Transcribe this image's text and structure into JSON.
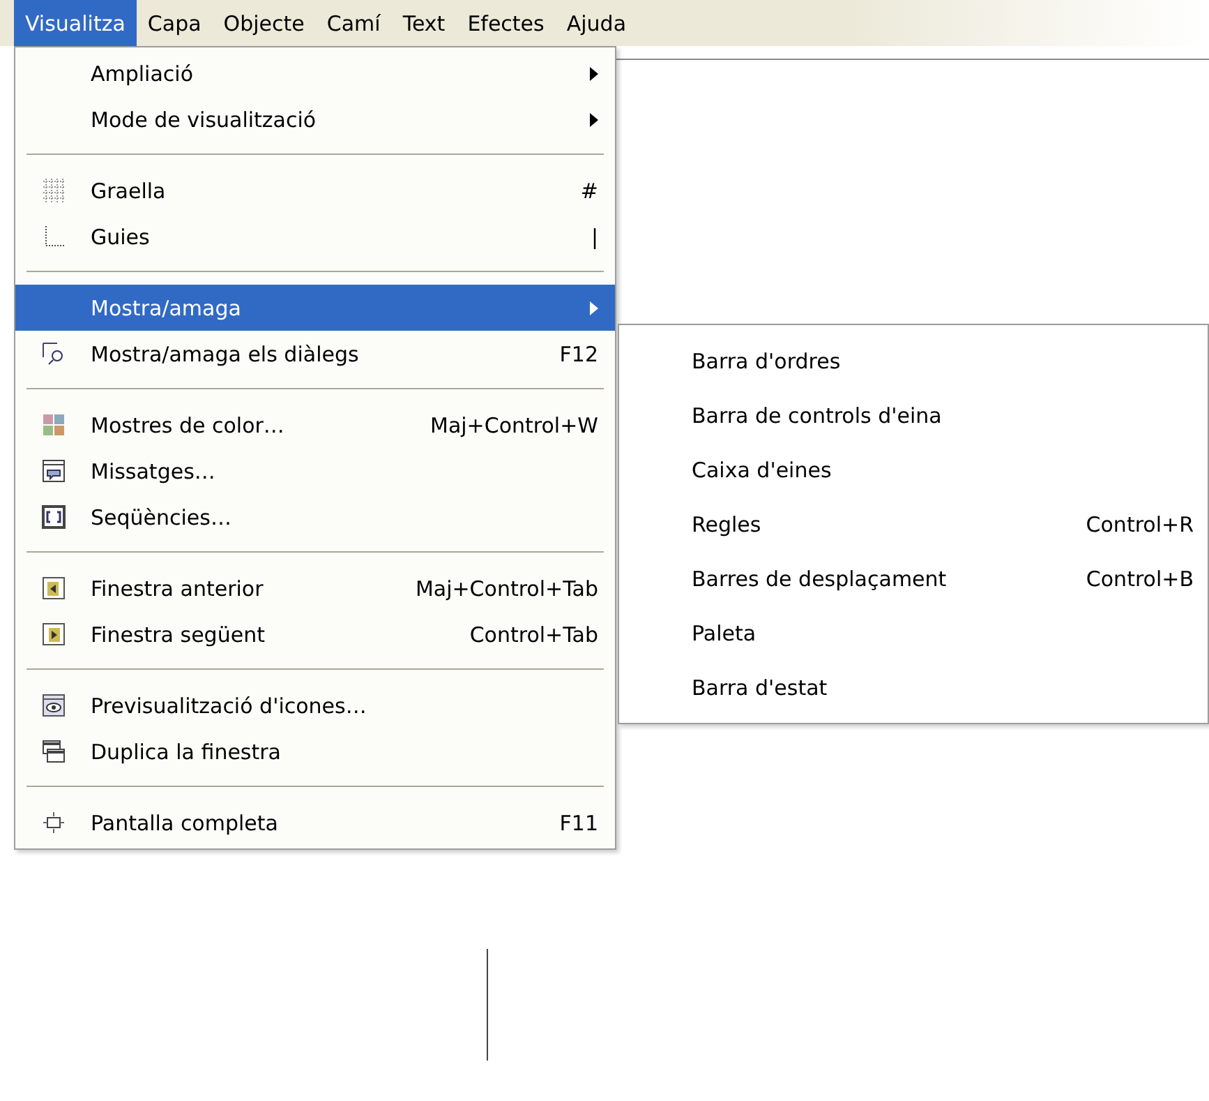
{
  "menubar": [
    {
      "label": "Visualitza",
      "selected": true
    },
    {
      "label": "Capa",
      "selected": false
    },
    {
      "label": "Objecte",
      "selected": false
    },
    {
      "label": "Camí",
      "selected": false
    },
    {
      "label": "Text",
      "selected": false
    },
    {
      "label": "Efectes",
      "selected": false
    },
    {
      "label": "Ajuda",
      "selected": false
    }
  ],
  "menu": [
    {
      "kind": "item",
      "label": "Ampliació",
      "submenu": true,
      "selected": false
    },
    {
      "kind": "item",
      "label": "Mode de visualització",
      "submenu": true,
      "selected": false
    },
    {
      "kind": "separator"
    },
    {
      "kind": "item",
      "label": "Graella",
      "shortcut": "#",
      "selected": false
    },
    {
      "kind": "item",
      "label": "Guies",
      "shortcut": "|",
      "selected": false
    },
    {
      "kind": "separator"
    },
    {
      "kind": "item",
      "label": "Mostra/amaga",
      "submenu": true,
      "selected": true
    },
    {
      "kind": "item",
      "label": "Mostra/amaga els diàlegs",
      "shortcut": "F12",
      "selected": false
    },
    {
      "kind": "separator"
    },
    {
      "kind": "item",
      "label": "Mostres de color…",
      "shortcut": "Maj+Control+W",
      "selected": false
    },
    {
      "kind": "item",
      "label": "Missatges…",
      "selected": false
    },
    {
      "kind": "item",
      "label": "Seqüències…",
      "selected": false
    },
    {
      "kind": "separator"
    },
    {
      "kind": "item",
      "label": "Finestra anterior",
      "shortcut": "Maj+Control+Tab",
      "selected": false
    },
    {
      "kind": "item",
      "label": "Finestra següent",
      "shortcut": "Control+Tab",
      "selected": false
    },
    {
      "kind": "separator"
    },
    {
      "kind": "item",
      "label": "Previsualització d'icones…",
      "selected": false
    },
    {
      "kind": "item",
      "label": "Duplica la finestra",
      "selected": false
    },
    {
      "kind": "separator"
    },
    {
      "kind": "item",
      "label": "Pantalla completa",
      "shortcut": "F11",
      "selected": false
    }
  ],
  "submenu": [
    {
      "label": "Barra d'ordres"
    },
    {
      "label": "Barra de controls d'eina"
    },
    {
      "label": "Caixa d'eines"
    },
    {
      "label": "Regles",
      "shortcut": "Control+R"
    },
    {
      "label": "Barres de desplaçament",
      "shortcut": "Control+B"
    },
    {
      "label": "Paleta"
    },
    {
      "label": "Barra d'estat"
    }
  ]
}
